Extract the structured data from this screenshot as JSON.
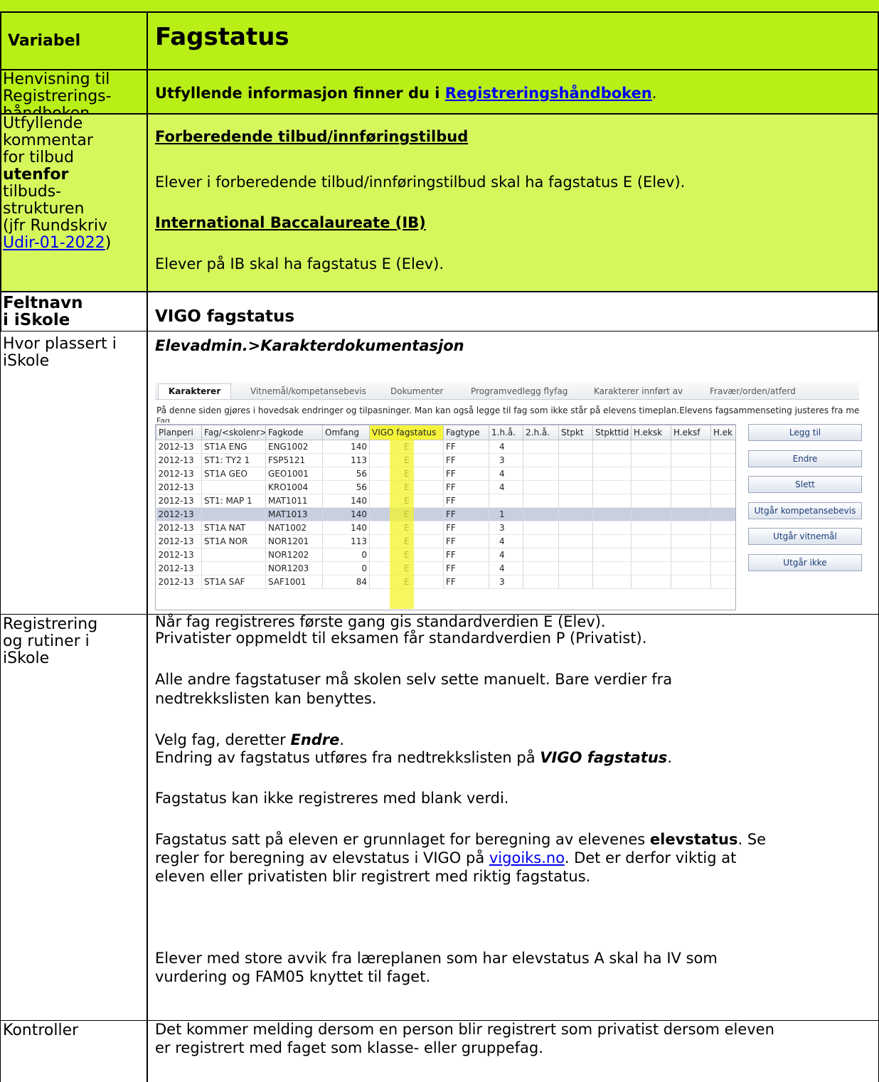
{
  "header": {
    "left": "Variabel",
    "title": "Fagstatus"
  },
  "reference": {
    "label_lines": [
      "Henvisning til",
      "Registrerings-",
      "håndboken"
    ],
    "text_before": "Utfyllende informasjon finner du i ",
    "link": "Registreringshåndboken",
    "text_after": "."
  },
  "comment": {
    "label_lines": [
      "Utfyllende",
      "kommentar",
      "for tilbud"
    ],
    "label_bold": "utenfor",
    "label_lines2": [
      "tilbuds-",
      "strukturen",
      "(jfr Rundskriv"
    ],
    "label_link": "Udir-01-2022",
    "label_close": ")",
    "heading1": "Forberedende tilbud/innføringstilbud",
    "para1": "Elever i forberedende tilbud/innføringstilbud skal ha fagstatus E (Elev).",
    "heading2": "International Baccalaureate (IB)",
    "para2": "Elever på IB skal ha fagstatus E (Elev)."
  },
  "field": {
    "label_lines": [
      "Feltnavn",
      "i iSkole"
    ],
    "value": "VIGO fagstatus"
  },
  "location": {
    "label_lines": [
      "Hvor plassert i",
      "iSkole"
    ],
    "path": "Elevadmin.>Karakterdokumentasjon"
  },
  "screenshot": {
    "tabs": [
      "Karakterer",
      "Vitnemål/kompetansebevis",
      "Dokumenter",
      "Programvedlegg flyfag",
      "Karakterer innført av",
      "Fravær/orden/atferd"
    ],
    "info": "På denne siden gjøres i hovedsak endringer og tilpasninger. Man kan også legge til fag som ikke står på elevens timeplan.Elevens fagsammenseting justeres fra menyvalget",
    "info2": "Fag",
    "columns": [
      "Planperi",
      "Fag/<skolenr>",
      "Fagkode",
      "Omfang",
      "VIGO fagstatus",
      "Fagtype",
      "1.h.å.",
      "2.h.å.",
      "Stpkt",
      "Stpkttid",
      "H.eksk",
      "H.eksf",
      "H.ek"
    ],
    "rows": [
      [
        "2012-13",
        "ST1A ENG",
        "ENG1002",
        "140",
        "E",
        "FF",
        "4"
      ],
      [
        "2012-13",
        "ST1: TY2 1",
        "FSP5121",
        "113",
        "E",
        "FF",
        "3"
      ],
      [
        "2012-13",
        "ST1A GEO",
        "GEO1001",
        "56",
        "E",
        "FF",
        "4"
      ],
      [
        "2012-13",
        "",
        "KRO1004",
        "56",
        "E",
        "FF",
        "4"
      ],
      [
        "2012-13",
        "ST1: MAP 1",
        "MAT1011",
        "140",
        "E",
        "FF",
        ""
      ],
      [
        "2012-13",
        "",
        "MAT1013",
        "140",
        "E",
        "FF",
        "1"
      ],
      [
        "2012-13",
        "ST1A NAT",
        "NAT1002",
        "140",
        "E",
        "FF",
        "3"
      ],
      [
        "2012-13",
        "ST1A NOR",
        "NOR1201",
        "113",
        "E",
        "FF",
        "4"
      ],
      [
        "2012-13",
        "",
        "NOR1202",
        "0",
        "E",
        "FF",
        "4"
      ],
      [
        "2012-13",
        "",
        "NOR1203",
        "0",
        "E",
        "FF",
        "4"
      ],
      [
        "2012-13",
        "ST1A SAF",
        "SAF1001",
        "84",
        "E",
        "FF",
        "3"
      ]
    ],
    "selected_row": 5,
    "buttons": [
      "Legg til",
      "Endre",
      "Slett",
      "Utgår kompetansebevis",
      "Utgår vitnemål",
      "Utgår ikke"
    ]
  },
  "registration": {
    "label_lines": [
      "Registrering",
      "og rutiner i",
      "iSkole"
    ],
    "l1": "Når fag registreres første gang gis standardverdien E (Elev).",
    "l2": "Privatister oppmeldt til eksamen får standardverdien P (Privatist).",
    "l3": "Alle andre fagstatuser må skolen selv sette manuelt. Bare verdier fra",
    "l4": "nedtrekkslisten kan benyttes.",
    "l5a": "Velg fag, deretter ",
    "l5b": "Endre",
    "l5c": ".",
    "l6a": "Endring av fagstatus utføres fra nedtrekkslisten på ",
    "l6b": "VIGO fagstatus",
    "l6c": ".",
    "l7": "Fagstatus kan ikke registreres med blank verdi.",
    "l8a": "Fagstatus satt på eleven er grunnlaget for beregning av elevenes ",
    "l8b": "elevstatus",
    "l8c": ". Se",
    "l9a": "regler for beregning av elevstatus i VIGO på ",
    "l9b": "vigoiks.no",
    "l9c": ". Det er derfor viktig at",
    "l10": "eleven eller privatisten blir registrert med riktig fagstatus.",
    "l11": "Elever med store avvik fra læreplanen som har elevstatus A skal ha IV som",
    "l12": "vurdering og FAM05 knyttet til faget."
  },
  "controls": {
    "label": "Kontroller",
    "l1": "Det kommer melding dersom en person blir registrert som privatist dersom eleven",
    "l2": "er registrert med faget som klasse- eller gruppefag."
  }
}
